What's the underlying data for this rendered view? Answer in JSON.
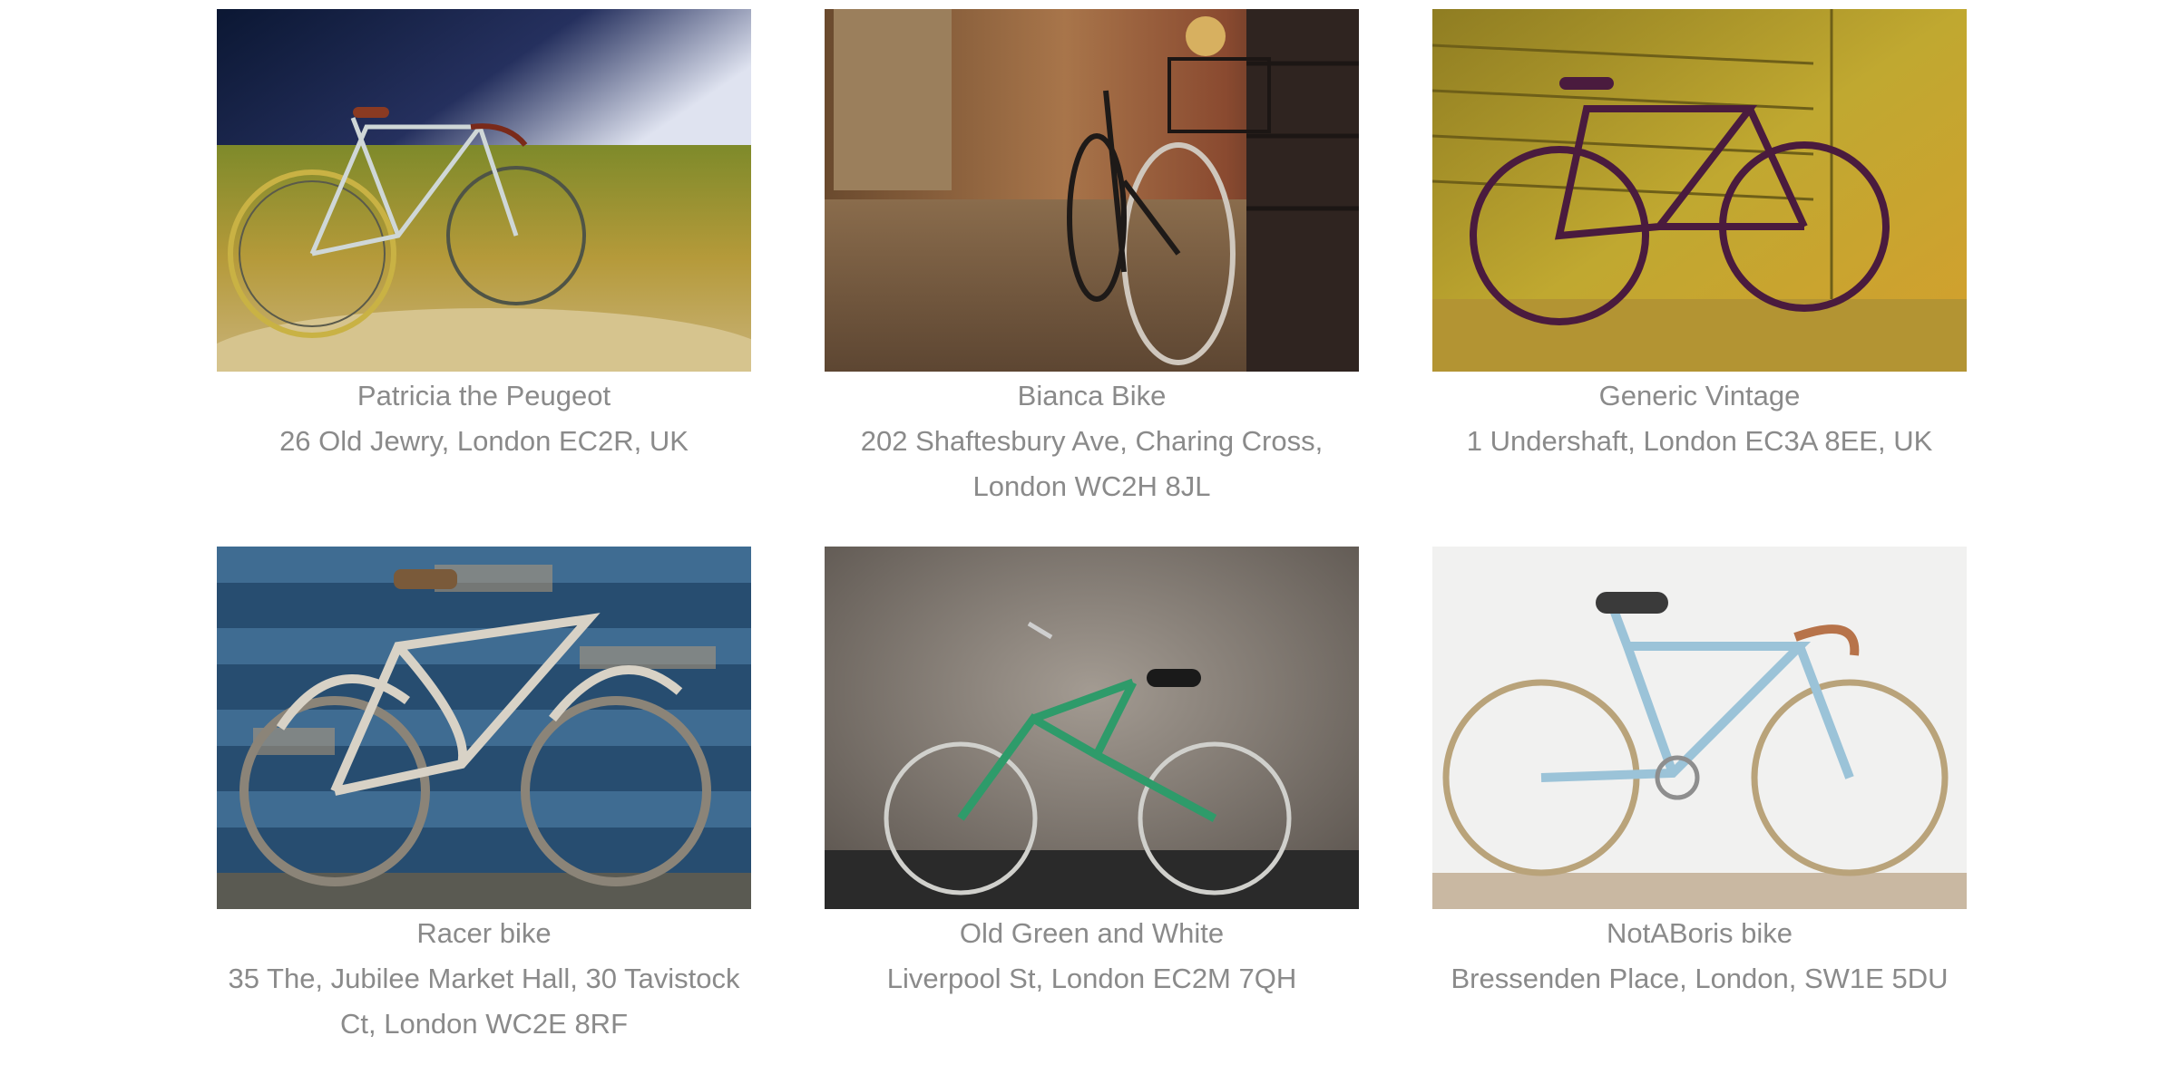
{
  "bikes": [
    {
      "name": "Patricia the Peugeot",
      "address": "26 Old Jewry, London EC2R, UK",
      "image": "bike-photo-field"
    },
    {
      "name": "Bianca Bike",
      "address": "202 Shaftesbury Ave, Charing Cross, London WC2H 8JL",
      "image": "bike-photo-cobblestone"
    },
    {
      "name": "Generic Vintage",
      "address": "1 Undershaft, London EC3A 8EE, UK",
      "image": "bike-photo-yellow-wall"
    },
    {
      "name": "Racer bike",
      "address": "35 The, Jubilee Market Hall, 30 Tavistock Ct, London WC2E 8RF",
      "image": "bike-photo-blue-wood"
    },
    {
      "name": "Old Green and White",
      "address": "Liverpool St, London EC2M 7QH",
      "image": "bike-photo-concrete-wall"
    },
    {
      "name": "NotABoris bike",
      "address": "Bressenden Place, London, SW1E 5DU",
      "image": "bike-photo-white-studio"
    }
  ],
  "colors": {
    "text": "#8a8a8a",
    "background": "#ffffff"
  }
}
